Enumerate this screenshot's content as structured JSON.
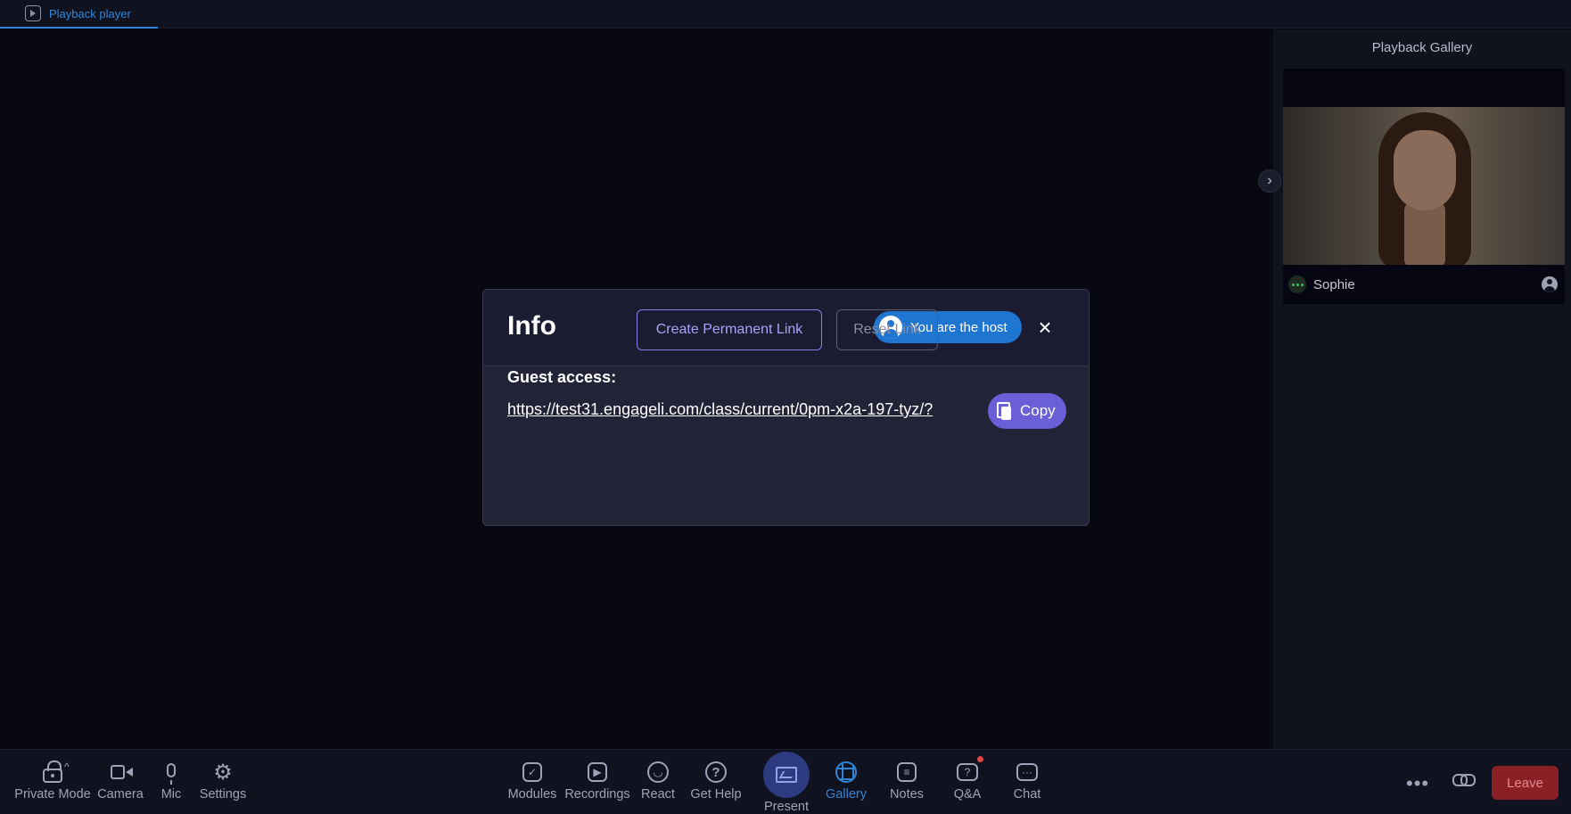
{
  "tab": {
    "label": "Playback player",
    "icon": "play-icon"
  },
  "sidebar": {
    "title": "Playback Gallery",
    "collapse_icon": "chevron-right-icon",
    "participant": {
      "name": "Sophie"
    }
  },
  "modal": {
    "title": "Info",
    "host_badge": "You are the host",
    "close_icon": "×",
    "create_link_label": "Create Permanent Link",
    "reset_link_label": "Reset Link",
    "guest_access_label": "Guest access:",
    "guest_link": "https://test31.engageli.com/class/current/0pm-x2a-197-tyz/?",
    "copy_label": "Copy"
  },
  "toolbar": {
    "left": [
      {
        "label": "Private Mode",
        "icon": "lock-icon"
      },
      {
        "label": "Camera",
        "icon": "camera-icon"
      },
      {
        "label": "Mic",
        "icon": "mic-icon"
      },
      {
        "label": "Settings",
        "icon": "gear-icon"
      }
    ],
    "center": [
      {
        "label": "Modules",
        "icon": "modules-icon"
      },
      {
        "label": "Recordings",
        "icon": "recordings-icon"
      },
      {
        "label": "React",
        "icon": "smile-icon"
      },
      {
        "label": "Get Help",
        "icon": "help-icon"
      },
      {
        "label": "Present",
        "icon": "present-icon"
      },
      {
        "label": "Gallery",
        "icon": "grid-icon"
      },
      {
        "label": "Notes",
        "icon": "notes-icon"
      },
      {
        "label": "Q&A",
        "icon": "qa-icon"
      },
      {
        "label": "Chat",
        "icon": "chat-icon"
      }
    ],
    "leave_label": "Leave"
  },
  "colors": {
    "accent": "#2f86d8",
    "host_badge": "#1f76d0",
    "copy_button": "#6a5fd6",
    "leave_button": "#8a1f26"
  }
}
